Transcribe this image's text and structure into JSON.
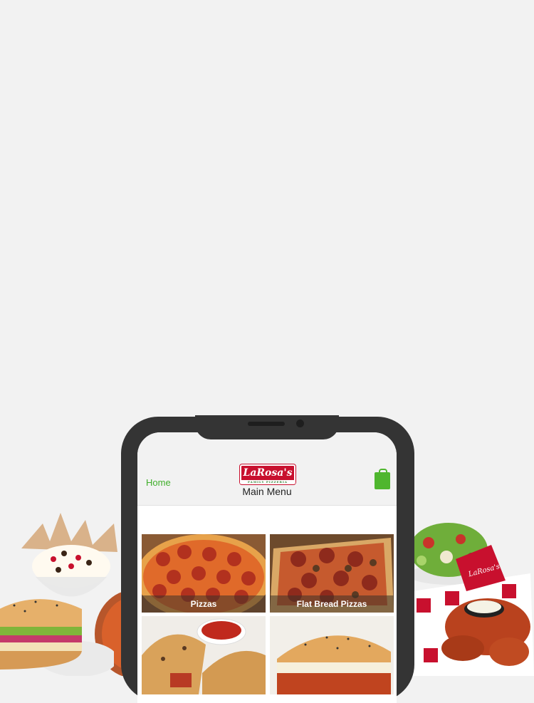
{
  "header": {
    "home_label": "Home",
    "logo_text": "LaRosa's",
    "logo_subtext": "FAMILY PIZZERIA",
    "title": "Main Menu",
    "bag_icon": "shopping-bag-icon"
  },
  "menu": {
    "tiles": [
      {
        "label": "Pizzas"
      },
      {
        "label": "Flat Bread Pizzas"
      },
      {
        "label": ""
      },
      {
        "label": ""
      }
    ]
  },
  "colors": {
    "accent_green": "#3fae2a",
    "brand_red": "#c8102e",
    "phone_frame": "#343434",
    "background": "#f2f2f2"
  }
}
